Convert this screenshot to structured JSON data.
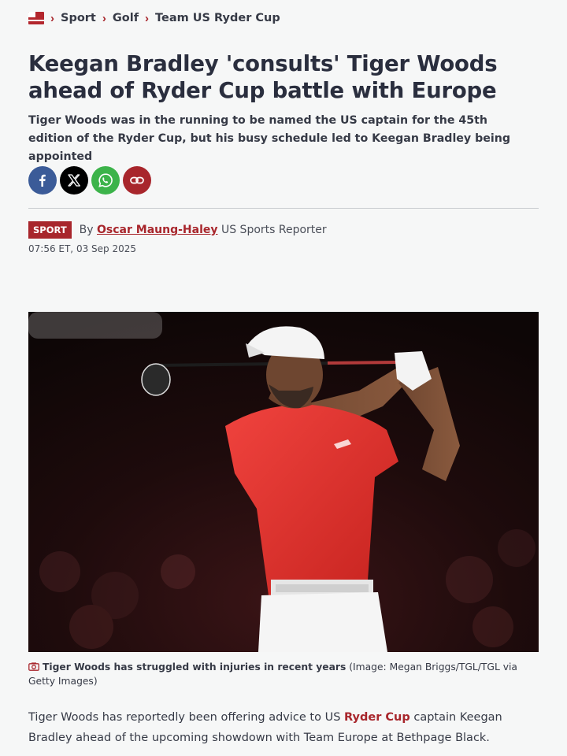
{
  "breadcrumb": {
    "items": [
      {
        "label": "Sport"
      },
      {
        "label": "Golf"
      },
      {
        "label": "Team US Ryder Cup"
      }
    ]
  },
  "article": {
    "headline": "Keegan Bradley 'consults' Tiger Woods ahead of Ryder Cup battle with Europe",
    "standfirst": "Tiger Woods was in the running to be named the US captain for the 45th edition of the Ryder Cup, but his busy schedule led to Keegan Bradley being appointed",
    "section_tag": "SPORT",
    "byline_prefix": "By",
    "author": "Oscar Maung-Haley",
    "author_role": "US Sports Reporter",
    "timestamp": "07:56 ET, 03 Sep 2025",
    "image_caption": "Tiger Woods has struggled with injuries in recent years",
    "image_credit": "(Image: Megan Briggs/TGL/TGL via Getty Images)",
    "body": {
      "before_link": "Tiger Woods has reportedly been offering advice to US ",
      "link_text": "Ryder Cup",
      "after_link": " captain Keegan Bradley ahead of the upcoming showdown with Team Europe at Bethpage Black."
    }
  },
  "share": {
    "buttons": [
      {
        "icon": "facebook-icon"
      },
      {
        "icon": "x-icon"
      },
      {
        "icon": "whatsapp-icon"
      },
      {
        "icon": "link-icon"
      }
    ]
  },
  "colors": {
    "accent": "#a8262c",
    "facebook": "#3b5b98",
    "x": "#000000",
    "whatsapp": "#3cb34a",
    "background": "#f6f7f7",
    "headline": "#2a2e3e"
  }
}
